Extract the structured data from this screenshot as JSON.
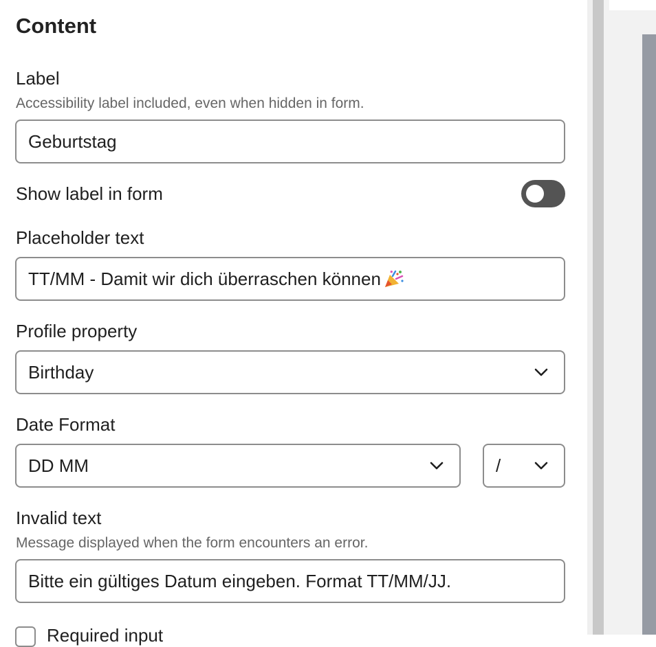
{
  "content": {
    "heading": "Content",
    "label_field": {
      "label": "Label",
      "hint": "Accessibility label included, even when hidden in form.",
      "value": "Geburtstag"
    },
    "show_label": {
      "label": "Show label in form",
      "toggle_on": false
    },
    "placeholder_field": {
      "label": "Placeholder text",
      "value": "TT/MM - Damit wir dich überraschen können",
      "trailing_icon": "party-popper-icon"
    },
    "profile_property": {
      "label": "Profile property",
      "selected": "Birthday"
    },
    "date_format": {
      "label": "Date Format",
      "format_selected": "DD MM",
      "separator_selected": "/"
    },
    "invalid_text": {
      "label": "Invalid text",
      "hint": "Message displayed when the form encounters an error.",
      "value": "Bitte ein gültiges Datum eingeben. Format TT/MM/JJ."
    },
    "required_input": {
      "label": "Required input",
      "checked": false
    }
  },
  "colors": {
    "border": "#8c8c8c",
    "toggle_off": "#545454",
    "hint_text": "#666666",
    "preview_bg": "#969ba4"
  }
}
